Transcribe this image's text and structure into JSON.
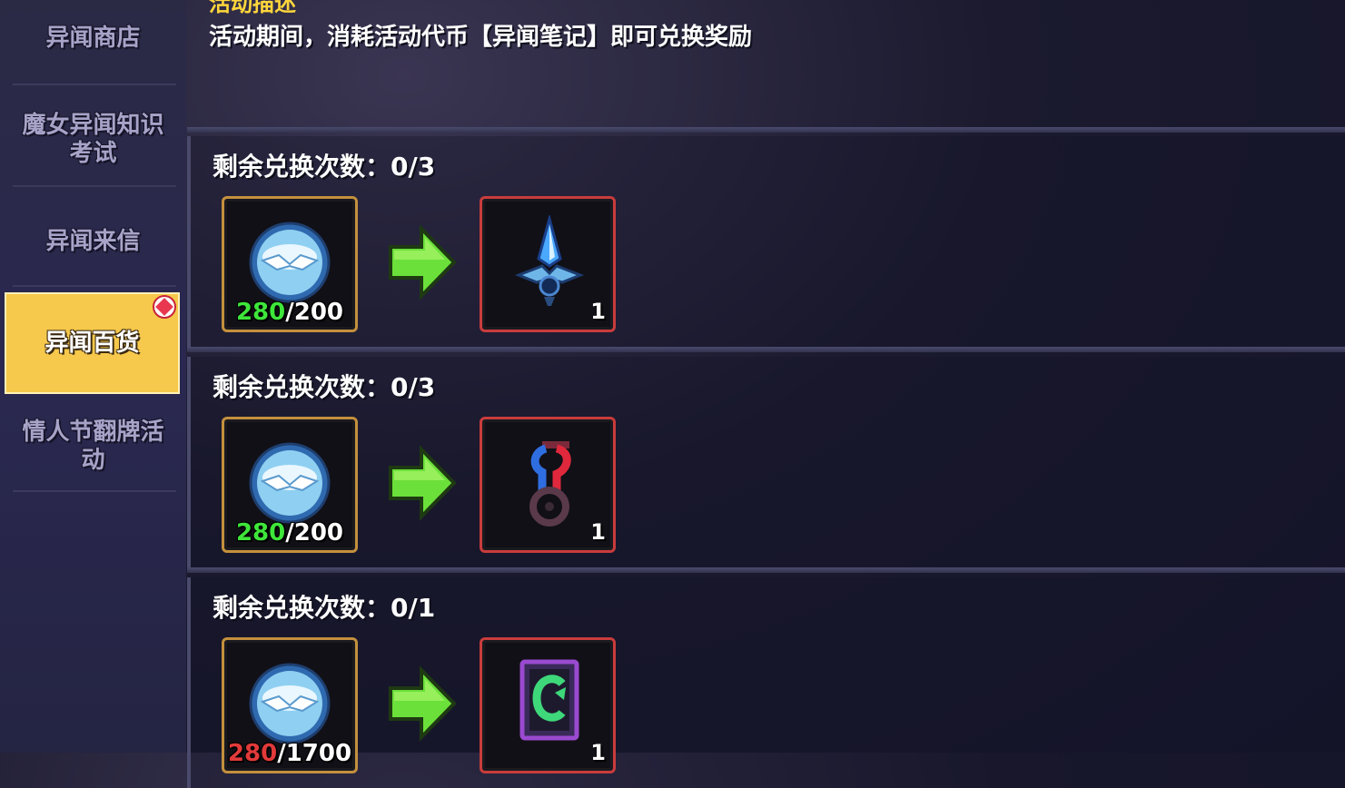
{
  "sidebar": {
    "items": [
      {
        "label": "异闻商店",
        "active": false
      },
      {
        "label": "魔女异闻知识\n考试",
        "active": false
      },
      {
        "label": "异闻来信",
        "active": false
      },
      {
        "label": "异闻百货",
        "active": true
      },
      {
        "label": "情人节翻牌活\n动",
        "active": false
      }
    ]
  },
  "description": {
    "title": "活动描述",
    "text": "活动期间，消耗活动代币【异闻笔记】即可兑换奖励"
  },
  "exchanges": [
    {
      "remaining_label": "剩余兑换次数：0/3",
      "cost_have": "280",
      "cost_need": "/200",
      "cost_icon": "coin-token-icon",
      "reward_icon": "crystal-dagger-icon",
      "reward_qty": "1"
    },
    {
      "remaining_label": "剩余兑换次数：0/3",
      "cost_have": "280",
      "cost_need": "/200",
      "cost_icon": "coin-token-icon",
      "reward_icon": "unicycle-icon",
      "reward_qty": "1"
    },
    {
      "remaining_label": "剩余兑换次数：0/1",
      "cost_have": "280",
      "cost_need": "/1700",
      "cost_icon": "coin-token-icon",
      "reward_icon": "green-c-card-icon",
      "reward_qty": "1"
    }
  ],
  "colors": {
    "active_tab": "#f6c84b",
    "cost_border": "#c4903d",
    "reward_border": "#c93c3c",
    "have_enough": "#3ee63a",
    "have_insufficient": "#e23a3a",
    "arrow": "#6be03a"
  }
}
